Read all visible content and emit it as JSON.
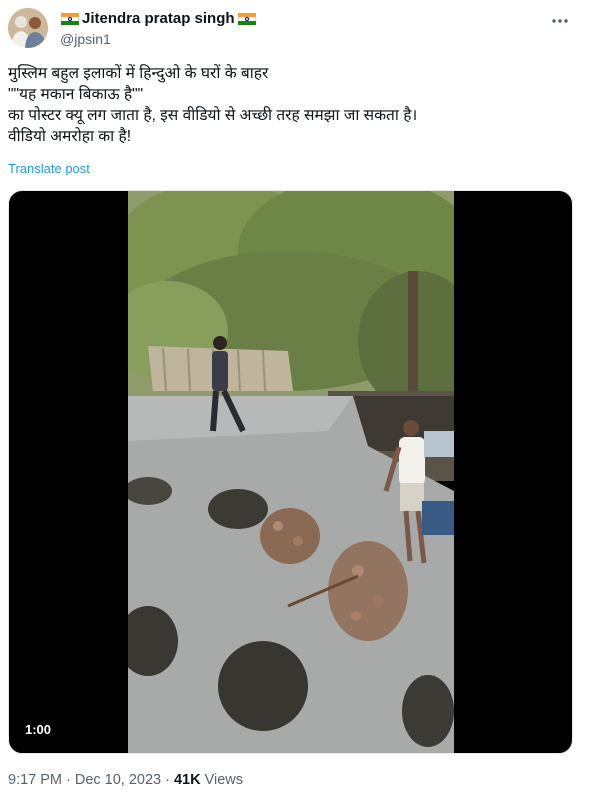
{
  "author": {
    "display_name": "Jitendra pratap singh",
    "handle": "@jpsin1",
    "avatar_icon": "profile-photo",
    "flag_icon": "india-flag-icon"
  },
  "menu_icon": "more-options-icon",
  "tweet": {
    "lines": [
      "मुस्लिम बहुल इलाकों में हिन्दुओ के घरों के बाहर",
      "\"\"यह मकान बिकाऊ है\"\"",
      "का पोस्टर क्यू लग जाता है, इस वीडियो से अच्छी तरह समझा जा सकता है।",
      "वीडियो अमरोहा का है!"
    ],
    "translate_label": "Translate post"
  },
  "video": {
    "duration": "1:00"
  },
  "meta": {
    "time": "9:17 PM",
    "separator": "·",
    "date": "Dec 10, 2023",
    "views_count": "41K",
    "views_label": "Views"
  },
  "colors": {
    "link": "#1d9bf0",
    "secondary_text": "#536471",
    "primary_text": "#0f1419"
  }
}
